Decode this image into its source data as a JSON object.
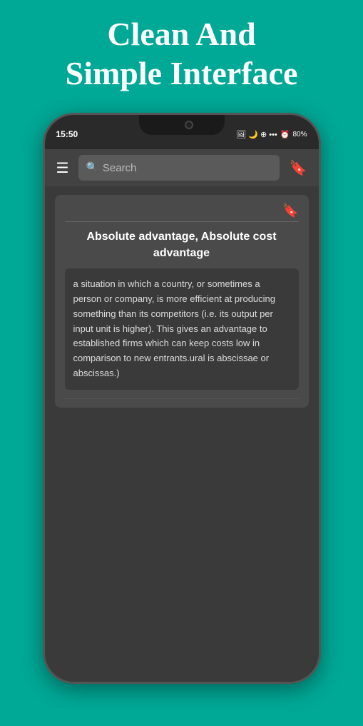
{
  "header": {
    "line1": "Clean And",
    "line2": "Simple Interface"
  },
  "status_bar": {
    "time": "15:50",
    "icons": "🖼 🌙 ⊕ •••",
    "right_icons": "⏰ 📶 80%"
  },
  "toolbar": {
    "search_placeholder": "Search",
    "menu_icon": "☰",
    "bookmark_icon": "🔖"
  },
  "card": {
    "title": "Absolute advantage, Absolute cost advantage",
    "bookmark_icon": "🔖",
    "definition": "a situation in which a country, or sometimes a person or company, is more efficient at producing something than its competitors (i.e. its output per input unit is higher). This gives an advantage to established firms which can keep costs low in comparison to new entrants.ural is abscissae or abscissas.)"
  },
  "colors": {
    "teal": "#00A896",
    "dark_bg": "#3a3a3a",
    "toolbar_bg": "#424242",
    "card_bg": "#4a4a4a"
  }
}
